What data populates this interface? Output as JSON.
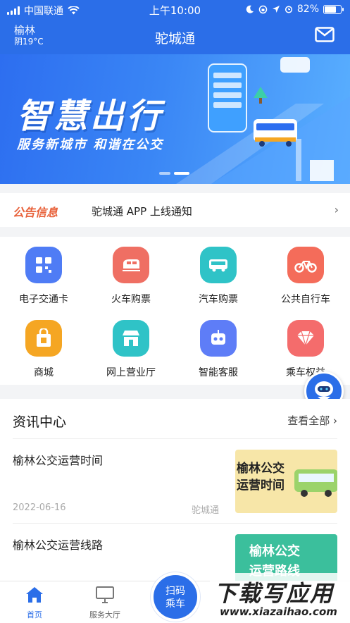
{
  "status_bar": {
    "carrier": "中国联通",
    "time": "上午10:00",
    "battery": "82%",
    "battery_level": 0.82
  },
  "header": {
    "city": "榆林",
    "weather": "阴19°C",
    "title": "驼城通",
    "icons": {
      "mail": "mail-icon"
    }
  },
  "banner": {
    "title": "智慧出行",
    "subtitle": "服务新城市 和谐在公交",
    "slide_count": 2,
    "active_slide": 2
  },
  "notice": {
    "tag": "公告信息",
    "text": "驼城通 APP 上线通知",
    "arrow": "›"
  },
  "services": [
    {
      "label": "电子交通卡",
      "icon": "qr-card-icon",
      "color": "#4f7cf5"
    },
    {
      "label": "火车购票",
      "icon": "train-icon",
      "color": "#ef6f63"
    },
    {
      "label": "汽车购票",
      "icon": "bus-icon",
      "color": "#2fc3c7"
    },
    {
      "label": "公共自行车",
      "icon": "bicycle-icon",
      "color": "#f46c5a"
    },
    {
      "label": "商城",
      "icon": "shopping-bag-icon",
      "color": "#f5a623"
    },
    {
      "label": "网上营业厅",
      "icon": "storefront-icon",
      "color": "#2fc3c7"
    },
    {
      "label": "智能客服",
      "icon": "robot-icon",
      "color": "#5e7df7"
    },
    {
      "label": "乘车权益",
      "icon": "diamond-icon",
      "color": "#f46c6c"
    }
  ],
  "news": {
    "title": "资讯中心",
    "more": "查看全部",
    "more_arrow": "›",
    "items": [
      {
        "title": "榆林公交运营时间",
        "date": "2022-06-16",
        "source": "驼城通",
        "thumb_text": [
          "榆林公交",
          "运营时间"
        ]
      },
      {
        "title": "榆林公交运营线路",
        "thumb_text": [
          "榆林公交",
          "运营路线"
        ]
      }
    ]
  },
  "tabbar": {
    "tabs": [
      {
        "label": "首页",
        "icon": "home-icon",
        "active": true
      },
      {
        "label": "服务大厅",
        "icon": "monitor-icon",
        "active": false
      }
    ],
    "scan": [
      "扫码",
      "乘车"
    ]
  },
  "watermark": {
    "main": "下载写应用",
    "sub": "www.xiazaihao.com"
  },
  "colors": {
    "primary": "#2b6ee8",
    "notice_tag": "#e8613a"
  }
}
